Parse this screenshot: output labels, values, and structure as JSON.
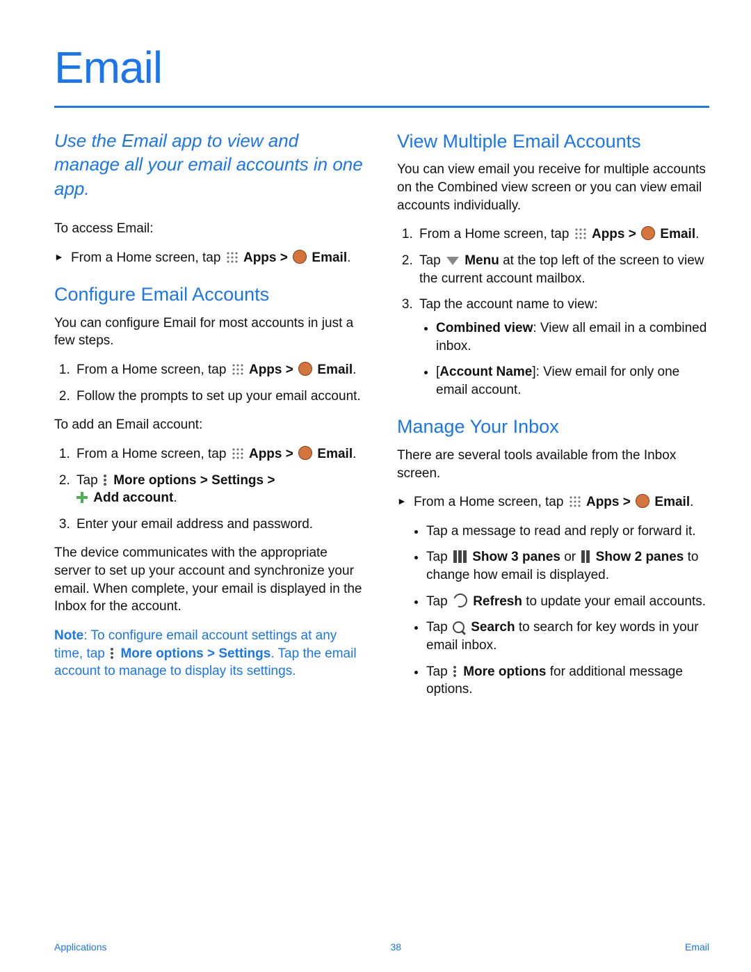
{
  "title": "Email",
  "intro": "Use the Email app to view and manage all your email accounts in one app.",
  "left": {
    "access_lead": "To access Email:",
    "access_line_pre": "From a Home screen, tap ",
    "apps_label": "Apps",
    "gt": " > ",
    "email_label": "Email",
    "period": ".",
    "configure_heading": "Configure Email Accounts",
    "configure_intro": "You can configure Email for most accounts in just a few steps.",
    "configure_step2": "Follow the prompts to set up your email account.",
    "add_lead": "To add an Email account:",
    "add_step2_pre": "Tap ",
    "add_step2_more": "More options",
    "add_step2_settings": "Settings",
    "add_step2_add": "Add account",
    "add_step3": "Enter your email address and password.",
    "device_para": "The device communicates with the appropriate server to set up your account and synchronize your email. When complete, your email is displayed in the Inbox for the account.",
    "note_label": "Note",
    "note_pre": ": To configure email account settings at any time, tap ",
    "note_more": "More options",
    "note_settings": "Settings",
    "note_post": ". Tap the email account to manage to display its settings."
  },
  "right": {
    "view_heading": "View Multiple Email Accounts",
    "view_intro": "You can view email you receive for multiple accounts on the Combined view screen or you can view email accounts individually.",
    "view_step2_pre": "Tap ",
    "view_step2_menu": "Menu",
    "view_step2_post": " at the top left of the screen to view the current account mailbox.",
    "view_step3": "Tap the account name to view:",
    "view_sub1_label": "Combined view",
    "view_sub1_post": ": View all email in a combined inbox.",
    "view_sub2_label": "Account Name",
    "view_sub2_post": ": View email for only one email account.",
    "manage_heading": "Manage Your Inbox",
    "manage_intro": "There are several tools available from the Inbox screen.",
    "bul1": "Tap a message to read and reply or forward it.",
    "bul2_pre": "Tap ",
    "bul2_a": "Show 3 panes",
    "bul2_or": " or ",
    "bul2_b": "Show 2 panes",
    "bul2_post": " to change how email is displayed.",
    "bul3_pre": "Tap ",
    "bul3_label": "Refresh",
    "bul3_post": " to update your email accounts.",
    "bul4_pre": "Tap ",
    "bul4_label": "Search",
    "bul4_post": " to search for key words in your email inbox.",
    "bul5_pre": "Tap ",
    "bul5_label": "More options",
    "bul5_post": " for additional message options."
  },
  "footer": {
    "left": "Applications",
    "center": "38",
    "right": "Email"
  }
}
